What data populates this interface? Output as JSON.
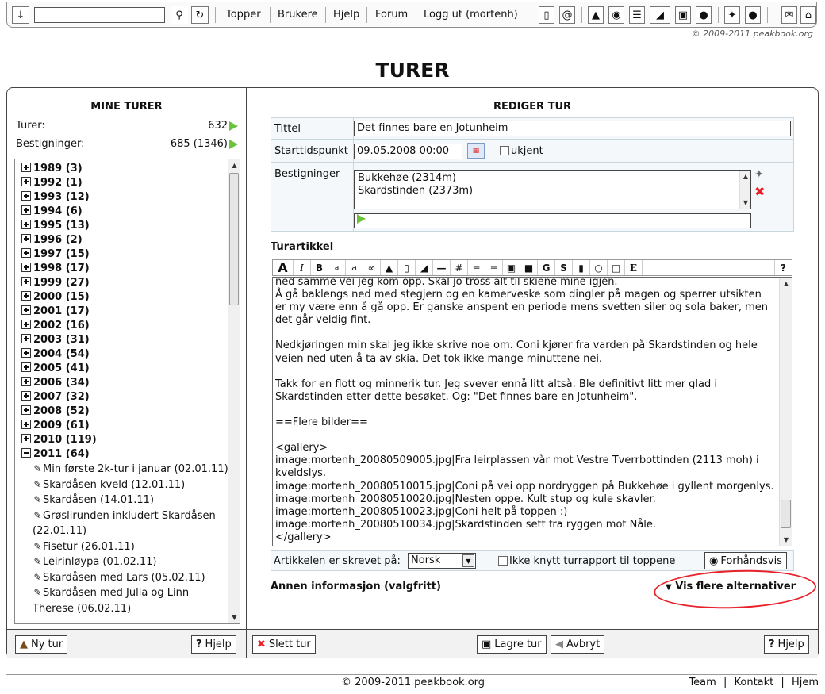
{
  "topbar": {
    "search_value": "",
    "links": [
      "Topper",
      "Brukere",
      "Hjelp",
      "Forum",
      "Logg ut (mortenh)"
    ],
    "copyright": "© 2009-2011 peakbook.org"
  },
  "page_title": "TURER",
  "left": {
    "heading": "MINE TURER",
    "stats": [
      {
        "label": "Turer:",
        "value": "632"
      },
      {
        "label": "Bestigninger:",
        "value": "685 (1346)"
      }
    ],
    "years": [
      {
        "label": "1989 (3)"
      },
      {
        "label": "1992 (1)"
      },
      {
        "label": "1993 (12)"
      },
      {
        "label": "1994 (6)"
      },
      {
        "label": "1995 (13)"
      },
      {
        "label": "1996 (2)"
      },
      {
        "label": "1997 (15)"
      },
      {
        "label": "1998 (17)"
      },
      {
        "label": "1999 (27)"
      },
      {
        "label": "2000 (15)"
      },
      {
        "label": "2001 (17)"
      },
      {
        "label": "2002 (16)"
      },
      {
        "label": "2003 (31)"
      },
      {
        "label": "2004 (54)"
      },
      {
        "label": "2005 (41)"
      },
      {
        "label": "2006 (34)"
      },
      {
        "label": "2007 (32)"
      },
      {
        "label": "2008 (52)"
      },
      {
        "label": "2009 (61)"
      },
      {
        "label": "2010 (119)"
      },
      {
        "label": "2011 (64)"
      }
    ],
    "trips_2011": [
      "Min første 2k-tur i januar (02.01.11)",
      "Skardåsen kveld (12.01.11)",
      "Skardåsen (14.01.11)",
      "Grøslirunden inkludert Skardåsen (22.01.11)",
      "Fisetur (26.01.11)",
      "Leirinløypa (01.02.11)",
      "Skardåsen med Lars (05.02.11)",
      "Skardåsen med Julia og Linn Therese (06.02.11)"
    ],
    "footer": {
      "new_trip": "Ny tur",
      "help": "Hjelp"
    }
  },
  "right": {
    "heading": "REDIGER TUR",
    "title_label": "Tittel",
    "title_value": "Det finnes bare en Jotunheim",
    "start_label": "Starttidspunkt",
    "start_value": "09.05.2008 00:00",
    "unknown_label": "ukjent",
    "ascents_label": "Bestigninger",
    "ascents": [
      "Bukkehøe (2314m)",
      "Skardstinden (2373m)"
    ],
    "ascent_input": "",
    "article_label": "Turartikkel",
    "article_text": "ned samme vei jeg kom opp. Skal jo tross alt til skiene mine igjen.\nÅ gå baklengs ned med stegjern og en kamerveske som dingler på magen og sperrer utsikten er my være enn å gå opp. Er ganske anspent en periode mens svetten siler og sola baker, men det går veldig fint.\n\nNedkjøringen min skal jeg ikke skrive noe om. Coni kjører fra varden på Skardstinden og hele veien ned uten å ta av skia. Det tok ikke mange minuttene nei.\n\nTakk for en flott og minnerik tur. Jeg svever ennå litt altså. Ble definitivt litt mer glad i Skardstinden etter dette besøket. Og: \"Det finnes bare en Jotunheim\".\n\n==Flere bilder==\n\n<gallery>\nimage:mortenh_20080509005.jpg|Fra leirplassen vår mot Vestre Tverrbottinden (2113 moh) i kveldslys.\nimage:mortenh_20080510015.jpg|Coni på vei opp nordryggen på Bukkehøe i gyllent morgenlys.\nimage:mortenh_20080510020.jpg|Nesten oppe. Kult stup og kule skavler.\nimage:mortenh_20080510023.jpg|Coni helt på toppen :)\nimage:mortenh_20080510034.jpg|Skardstinden sett fra ryggen mot Nåle.\n</gallery>",
    "language_label": "Artikkelen er skrevet på:",
    "language_value": "Norsk",
    "no_link_label": "Ikke knytt turrapport til toppene",
    "preview_label": "Forhåndsvis",
    "other_info": "Annen informasjon (valgfritt)",
    "more_options": "Vis flere alternativer",
    "footer": {
      "delete": "Slett tur",
      "save": "Lagre tur",
      "cancel": "Avbryt",
      "help": "Hjelp"
    }
  },
  "bottom": {
    "copyright": "© 2009-2011 peakbook.org",
    "links": [
      "Team",
      "Kontakt",
      "Hjem"
    ]
  },
  "colors": {
    "accent_green": "#6bc23b",
    "delete_red": "#e8212a",
    "panel_bg": "#eaf1f6"
  }
}
